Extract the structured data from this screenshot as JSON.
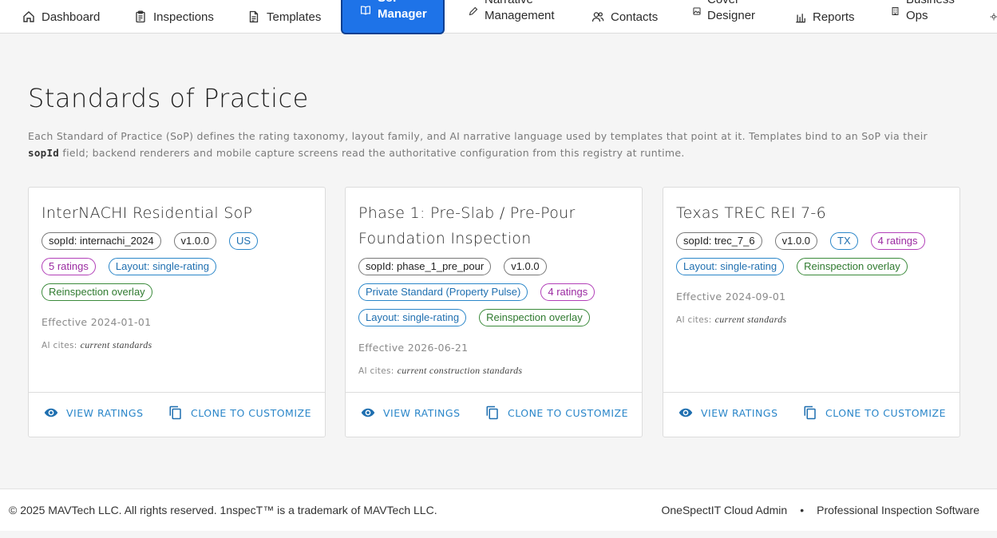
{
  "nav": {
    "items": [
      {
        "label": "Dashboard",
        "icon": "home-icon"
      },
      {
        "label": "Inspections",
        "icon": "clipboard-icon"
      },
      {
        "label": "Templates",
        "icon": "document-icon"
      },
      {
        "label": "SoP Manager",
        "icon": "book-icon",
        "active": true
      },
      {
        "label": "Narrative Management",
        "icon": "pen-icon"
      },
      {
        "label": "Contacts",
        "icon": "users-icon"
      },
      {
        "label": "Cover Designer",
        "icon": "image-icon"
      },
      {
        "label": "Reports",
        "icon": "bar-chart-icon"
      },
      {
        "label": "Business Ops",
        "icon": "building-icon"
      }
    ]
  },
  "page": {
    "title": "Standards of Practice",
    "description_before": "Each Standard of Practice (SoP) defines the rating taxonomy, layout family, and AI narrative language used by templates that point at it. Templates bind to an SoP via their ",
    "description_code": "sopId",
    "description_after": " field; backend renderers and mobile capture screens read the authoritative configuration from this registry at runtime."
  },
  "cards": [
    {
      "title": "InterNACHI Residential SoP",
      "chips": [
        {
          "text": "sopId: internachi_2024",
          "color": "gray"
        },
        {
          "text": "v1.0.0",
          "color": "gray"
        },
        {
          "text": "US",
          "color": "blue"
        },
        {
          "text": "5 ratings",
          "color": "purple"
        },
        {
          "text": "Layout: single-rating",
          "color": "blue"
        },
        {
          "text": "Reinspection overlay",
          "color": "green"
        }
      ],
      "effective_label": "Effective",
      "effective_date": "2024-01-01",
      "cites_label": "AI cites:",
      "cites_value": "current standards"
    },
    {
      "title": "Phase 1: Pre-Slab / Pre-Pour Foundation Inspection",
      "chips": [
        {
          "text": "sopId: phase_1_pre_pour",
          "color": "gray"
        },
        {
          "text": "v1.0.0",
          "color": "gray"
        },
        {
          "text": "Private Standard (Property Pulse)",
          "color": "blue"
        },
        {
          "text": "4 ratings",
          "color": "purple"
        },
        {
          "text": "Layout: single-rating",
          "color": "blue"
        },
        {
          "text": "Reinspection overlay",
          "color": "green"
        }
      ],
      "effective_label": "Effective",
      "effective_date": "2026-06-21",
      "cites_label": "AI cites:",
      "cites_value": "current construction standards"
    },
    {
      "title": "Texas TREC REI 7-6",
      "chips": [
        {
          "text": "sopId: trec_7_6",
          "color": "gray"
        },
        {
          "text": "v1.0.0",
          "color": "gray"
        },
        {
          "text": "TX",
          "color": "blue"
        },
        {
          "text": "4 ratings",
          "color": "purple"
        },
        {
          "text": "Layout: single-rating",
          "color": "blue"
        },
        {
          "text": "Reinspection overlay",
          "color": "green"
        }
      ],
      "effective_label": "Effective",
      "effective_date": "2024-09-01",
      "cites_label": "AI cites:",
      "cites_value": "current standards"
    }
  ],
  "actions": {
    "view_label": "VIEW RATINGS",
    "view_icon": "eye-icon",
    "clone_label": "CLONE TO CUSTOMIZE",
    "clone_icon": "copy-icon"
  },
  "footer": {
    "copyright": "© 2025 MAVTech LLC. All rights reserved. 1nspecT™ is a trademark of MAVTech LLC.",
    "link1": "OneSpectIT Cloud Admin",
    "separator": "•",
    "link2": "Professional Inspection Software"
  },
  "colors": {
    "accent": "#1e73e8",
    "chip_blue": "#2a86c9",
    "chip_purple": "#b23fb8",
    "chip_green": "#3a8a3a"
  }
}
